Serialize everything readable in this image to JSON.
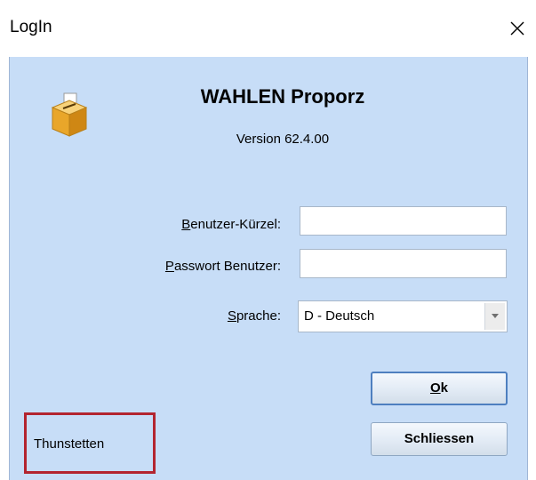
{
  "window": {
    "title": "LogIn"
  },
  "header": {
    "app_name": "WAHLEN Proporz",
    "version": "Version 62.4.00"
  },
  "form": {
    "user_label_accel": "B",
    "user_label_rest": "enutzer-Kürzel:",
    "user_value": "",
    "password_label_accel": "P",
    "password_label_rest": "asswort Benutzer:",
    "password_value": "",
    "language_label_accel": "S",
    "language_label_rest": "prache:",
    "language_selected": "D - Deutsch"
  },
  "buttons": {
    "ok_accel": "O",
    "ok_rest": "k",
    "close_label": "Schliessen"
  },
  "footer": {
    "municipality": "Thunstetten"
  },
  "colors": {
    "client_bg": "#c7ddf7",
    "highlight_border": "#b3242f",
    "default_button_border": "#4e7fbf"
  },
  "icons": {
    "logo": "ballot-box-icon",
    "close": "close-icon",
    "dropdown": "chevron-down-icon"
  }
}
